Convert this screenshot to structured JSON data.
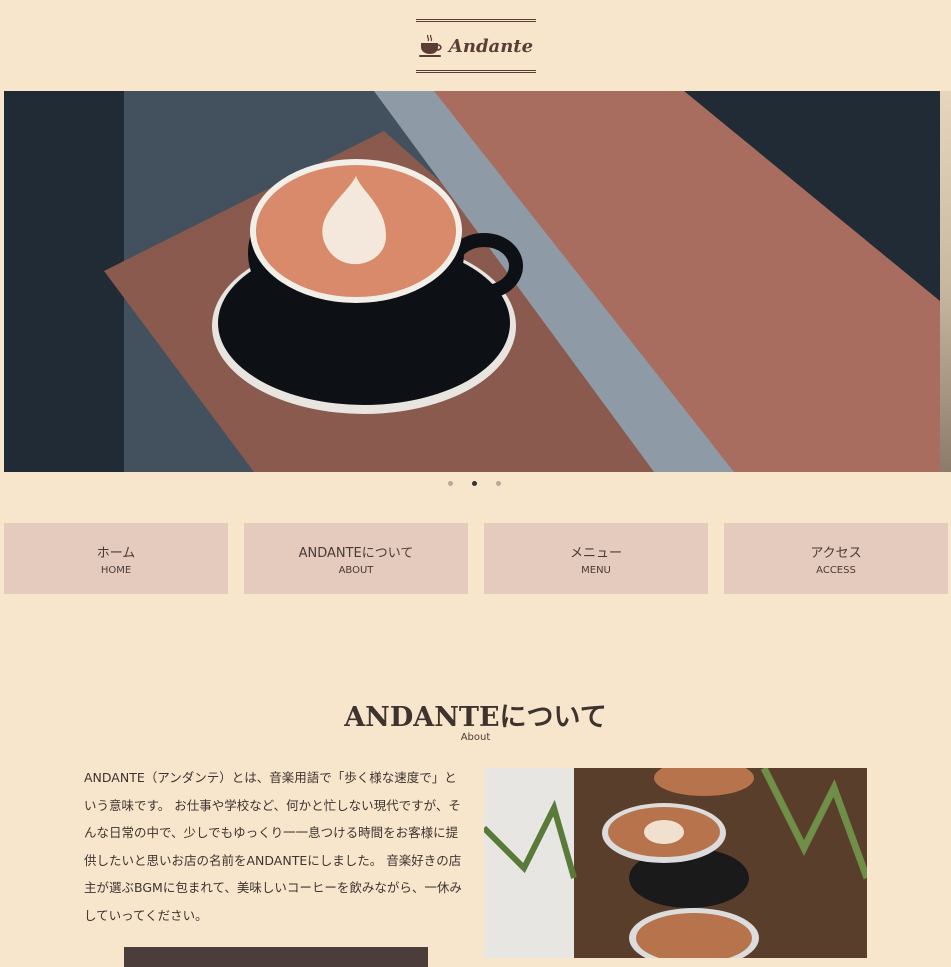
{
  "header": {
    "logo_text": "Andante"
  },
  "slider": {
    "dots": 3,
    "active_index": 1
  },
  "nav": {
    "items": [
      {
        "jp": "ホーム",
        "en": "HOME"
      },
      {
        "jp": "ANDANTEについて",
        "en": "ABOUT"
      },
      {
        "jp": "メニュー",
        "en": "MENU"
      },
      {
        "jp": "アクセス",
        "en": "ACCESS"
      }
    ]
  },
  "about": {
    "title": "ANDANTEについて",
    "subtitle": "About",
    "body": "ANDANTE（アンダンテ）とは、音楽用語で「歩く様な速度で」という意味です。 お仕事や学校など、何かと忙しない現代ですが、そんな日常の中で、少しでもゆっくり一一息つける時間をお客様に提供したいと思いお店の名前をANDANTEにしました。 音楽好きの店主が選ぶBGMに包まれて、美味しいコーヒーを飲みながら、一休みしていってください。"
  },
  "colors": {
    "background": "#f7e6cc",
    "nav_bg": "#e4cbbd",
    "text": "#4a3a35",
    "button": "#4a3d3a"
  }
}
